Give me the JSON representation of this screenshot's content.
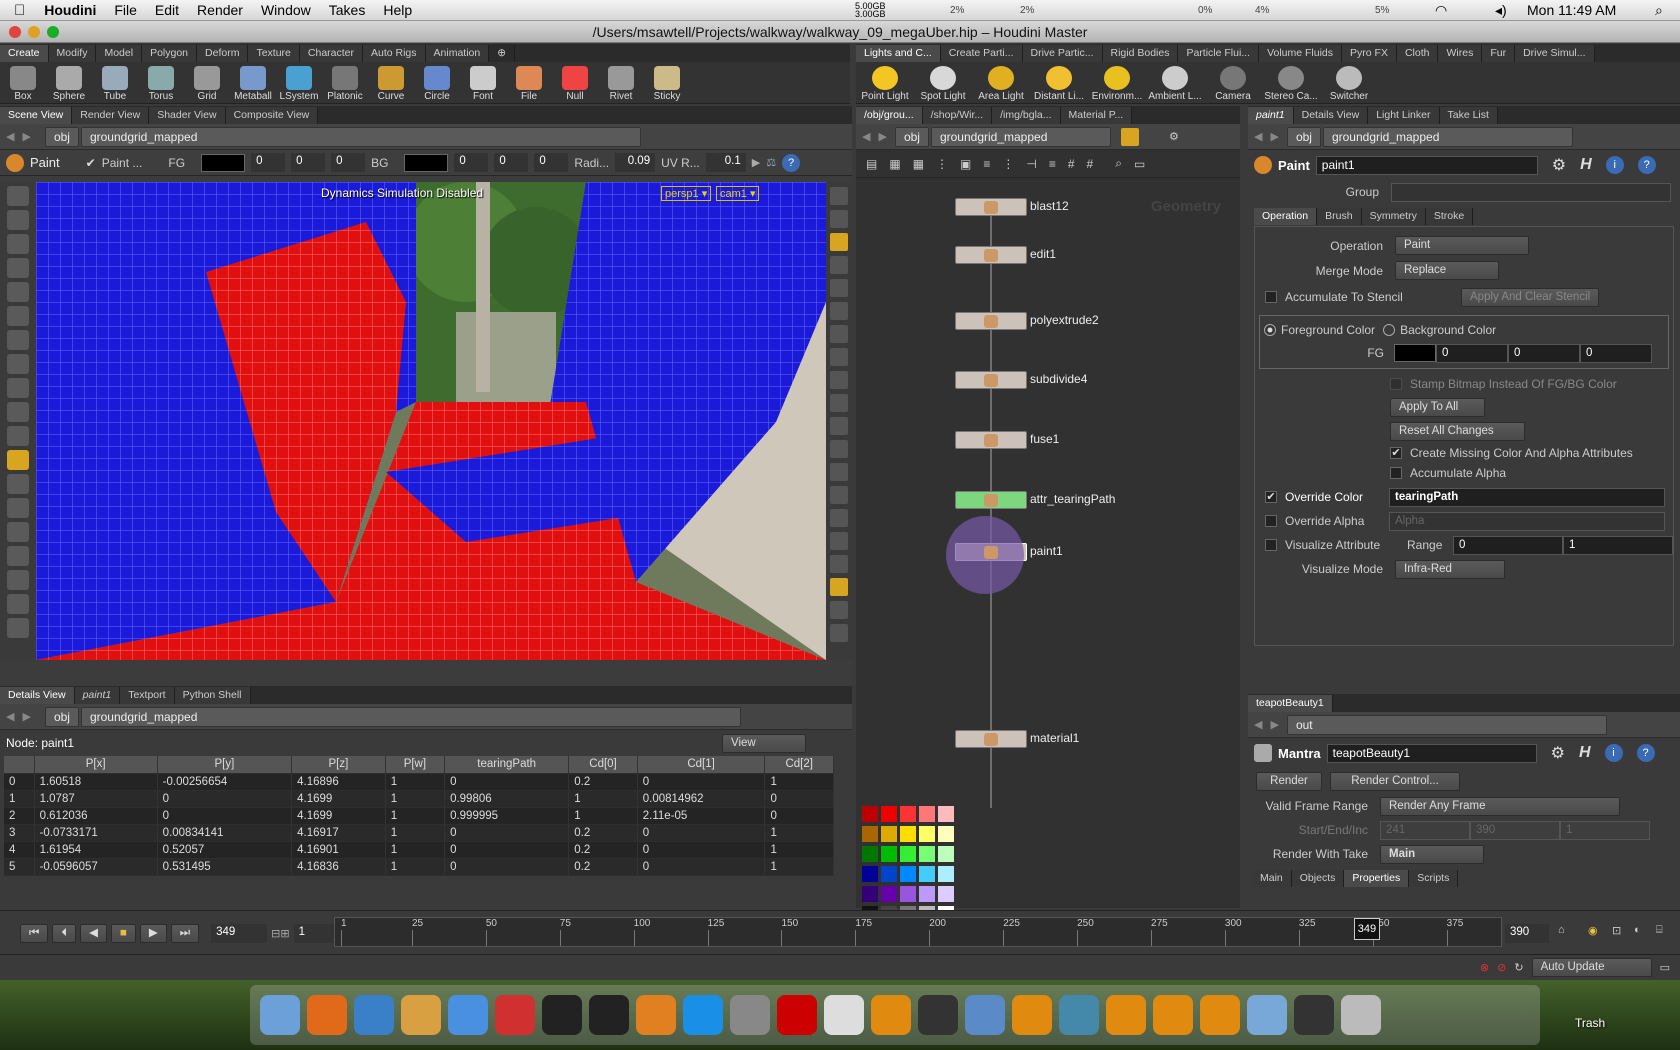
{
  "menubar": {
    "app": "Houdini",
    "items": [
      "File",
      "Edit",
      "Render",
      "Window",
      "Takes",
      "Help"
    ],
    "mem": "5.00GB\n3.00GB",
    "clock": "Mon 11:49 AM",
    "pcts": [
      "2%",
      "2%",
      "0%",
      "4%",
      "5%"
    ]
  },
  "window": {
    "title": "/Users/msawtell/Projects/walkway/walkway_09_megaUber.hip – Houdini Master"
  },
  "left_shelf": {
    "tabs": [
      "Create",
      "Modify",
      "Model",
      "Polygon",
      "Deform",
      "Texture",
      "Character",
      "Auto Rigs",
      "Animation"
    ],
    "tools": [
      "Box",
      "Sphere",
      "Tube",
      "Torus",
      "Grid",
      "Metaball",
      "LSystem",
      "Platonic ...",
      "Curve",
      "Circle",
      "Font",
      "File",
      "Null",
      "Rivet",
      "Sticky"
    ]
  },
  "right_shelf": {
    "tabs": [
      "Lights and C...",
      "Create Parti...",
      "Drive Partic...",
      "Rigid Bodies",
      "Particle Flui...",
      "Volume Fluids",
      "Pyro FX",
      "Cloth",
      "Wires",
      "Fur",
      "Drive Simul..."
    ],
    "tools": [
      "Point Light",
      "Spot Light",
      "Area Light",
      "Distant Li...",
      "Environm...",
      "Ambient L...",
      "Camera",
      "Stereo Ca...",
      "Switcher"
    ]
  },
  "viewer": {
    "tabs": [
      "Scene View",
      "Render View",
      "Shader View",
      "Composite View"
    ],
    "path_root": "obj",
    "path_node": "groundgrid_mapped",
    "op": "Paint",
    "paint_label": "Paint ...",
    "fg_label": "FG",
    "fg": [
      "0",
      "0",
      "0"
    ],
    "bg_label": "BG",
    "bg": [
      "0",
      "0",
      "0"
    ],
    "radius_label": "Radi...",
    "radius": "0.09",
    "uv_label": "UV R...",
    "uv": "0.1",
    "overlay": "Dynamics Simulation Disabled",
    "cam1": "persp1 ▾",
    "cam2": "cam1 ▾"
  },
  "network": {
    "tabs": [
      "/obj/grou...",
      "/shop/Wir...",
      "/img/bgla...",
      "Material P..."
    ],
    "path_root": "obj",
    "path_node": "groundgrid_mapped",
    "watermark": "Geometry",
    "nodes": [
      "blast12",
      "edit1",
      "polyextrude2",
      "subdivide4",
      "fuse1",
      "attr_tearingPath",
      "paint1",
      "material1"
    ]
  },
  "params": {
    "tabs": [
      "paint1",
      "Details View",
      "Light Linker",
      "Take List"
    ],
    "path_root": "obj",
    "path_node": "groundgrid_mapped",
    "type": "Paint",
    "name": "paint1",
    "group_label": "Group",
    "subtabs": [
      "Operation",
      "Brush",
      "Symmetry",
      "Stroke"
    ],
    "operation_label": "Operation",
    "operation": "Paint",
    "merge_label": "Merge Mode",
    "merge": "Replace",
    "accum_stencil": "Accumulate To Stencil",
    "apply_clear": "Apply And Clear Stencil",
    "fg_color": "Foreground Color",
    "bg_color": "Background Color",
    "fg_label": "FG",
    "fg": [
      "0",
      "0",
      "0"
    ],
    "stamp": "Stamp Bitmap Instead Of FG/BG Color",
    "apply_all": "Apply To All",
    "reset_all": "Reset All Changes",
    "create_missing": "Create Missing Color And Alpha Attributes",
    "accum_alpha": "Accumulate Alpha",
    "override_color": "Override Color",
    "override_color_val": "tearingPath",
    "override_alpha": "Override Alpha",
    "override_alpha_val": "Alpha",
    "vis_attr": "Visualize Attribute",
    "range_label": "Range",
    "range": [
      "0",
      "1"
    ],
    "vis_mode_label": "Visualize Mode",
    "vis_mode": "Infra-Red"
  },
  "mantra": {
    "tab": "teapotBeauty1",
    "path": "out",
    "type": "Mantra",
    "name": "teapotBeauty1",
    "render": "Render",
    "render_ctl": "Render Control...",
    "valid_label": "Valid Frame Range",
    "valid": "Render Any Frame",
    "sei_label": "Start/End/Inc",
    "sei": [
      "241",
      "390",
      "1"
    ],
    "take_label": "Render With Take",
    "take": "Main",
    "subtabs": [
      "Main",
      "Objects",
      "Properties",
      "Scripts"
    ]
  },
  "details": {
    "tabs": [
      "Details View",
      "paint1",
      "Textport",
      "Python Shell"
    ],
    "path_root": "obj",
    "path_node": "groundgrid_mapped",
    "node_label": "Node: paint1",
    "view": "View",
    "columns": [
      "",
      "P[x]",
      "P[y]",
      "P[z]",
      "P[w]",
      "tearingPath",
      "Cd[0]",
      "Cd[1]",
      "Cd[2]"
    ],
    "rows": [
      [
        "0",
        "1.60518",
        "-0.00256654",
        "4.16896",
        "1",
        "0",
        "0.2",
        "0",
        "1"
      ],
      [
        "1",
        "1.0787",
        "0",
        "4.1699",
        "1",
        "0.99806",
        "1",
        "0.00814962",
        "0"
      ],
      [
        "2",
        "0.612036",
        "0",
        "4.1699",
        "1",
        "0.999995",
        "1",
        "2.11e-05",
        "0"
      ],
      [
        "3",
        "-0.0733171",
        "0.00834141",
        "4.16917",
        "1",
        "0",
        "0.2",
        "0",
        "1"
      ],
      [
        "4",
        "1.61954",
        "0.52057",
        "4.16901",
        "1",
        "0",
        "0.2",
        "0",
        "1"
      ],
      [
        "5",
        "-0.0596057",
        "0.531495",
        "4.16836",
        "1",
        "0",
        "0.2",
        "0",
        "1"
      ]
    ]
  },
  "timeline": {
    "frame": "349",
    "step": "1",
    "ticks": [
      "1",
      "25",
      "50",
      "75",
      "100",
      "125",
      "150",
      "175",
      "200",
      "225",
      "250",
      "275",
      "300",
      "325",
      "350",
      "375"
    ],
    "cursor": "349",
    "end": "390",
    "update": "Auto Update"
  },
  "dock": {
    "trash": "Trash"
  }
}
